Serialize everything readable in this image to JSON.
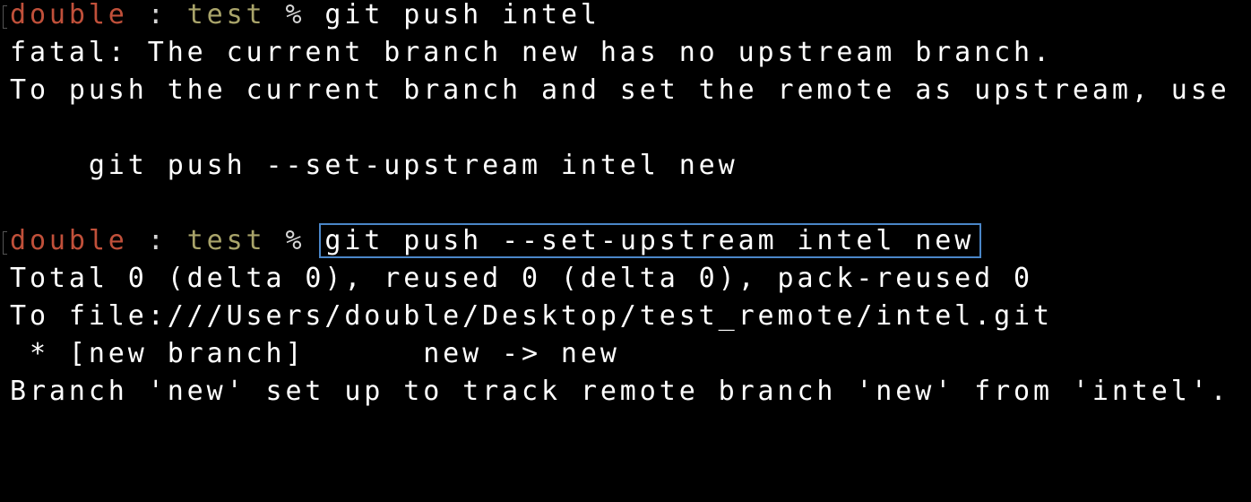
{
  "prompt": {
    "user": "double",
    "separator": " : ",
    "directory": "test",
    "symbol": " % "
  },
  "lines": {
    "cmd1": "git push intel",
    "fatal": "fatal: The current branch new has no upstream branch.",
    "hint": "To push the current branch and set the remote as upstream, use",
    "suggestion": "    git push --set-upstream intel new",
    "cmd2": "git push --set-upstream intel new",
    "total": "Total 0 (delta 0), reused 0 (delta 0), pack-reused 0",
    "to": "To file:///Users/double/Desktop/test_remote/intel.git",
    "new_branch": " * [new branch]      new -> new",
    "tracking": "Branch 'new' set up to track remote branch 'new' from 'intel'."
  },
  "colors": {
    "background": "#000000",
    "text": "#ffffff",
    "user": "#c0503a",
    "directory": "#a9a46a",
    "highlight_border": "#4a86c8"
  }
}
